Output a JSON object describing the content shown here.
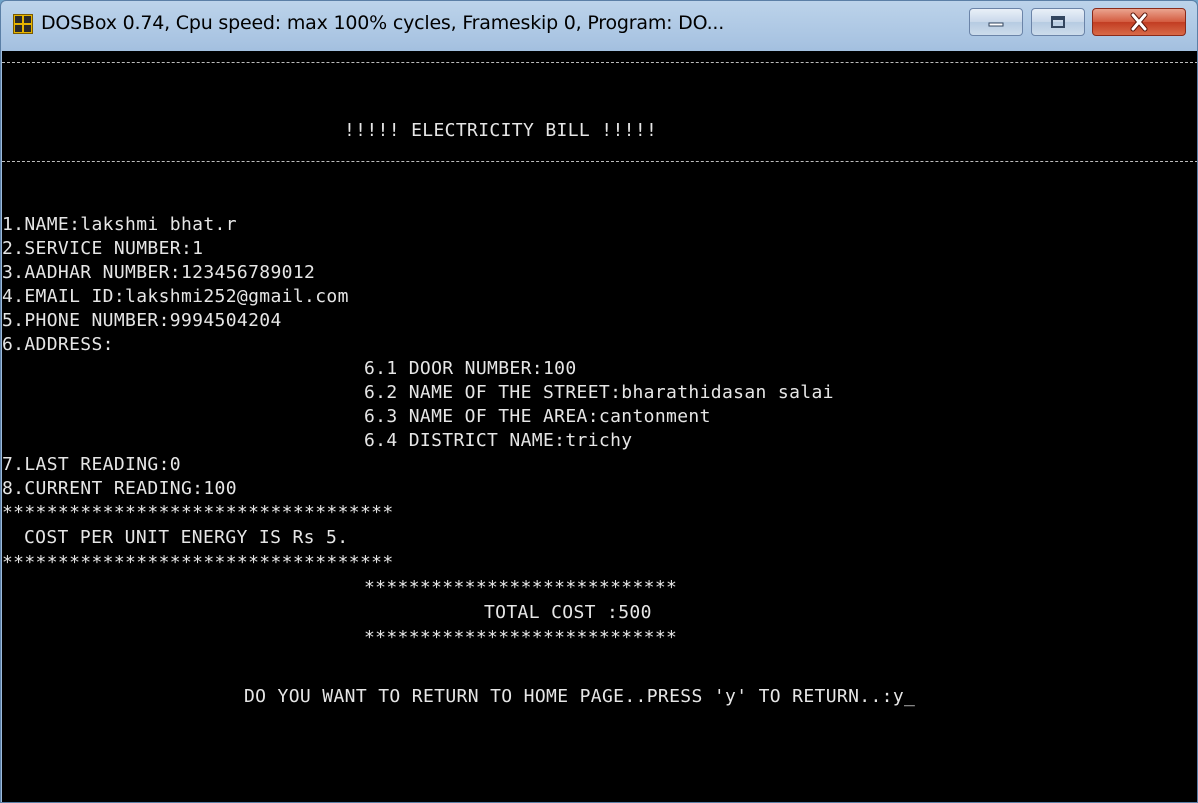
{
  "window": {
    "title": "DOSBox 0.74, Cpu speed: max 100% cycles, Frameskip  0, Program:   DO...",
    "icon": "dosbox-icon",
    "controls": [
      "minimize-icon",
      "maximize-icon",
      "close-icon"
    ]
  },
  "colors": {
    "close_button": "#c8442a",
    "screen_background": "#000000",
    "text": "#e6e6e6"
  },
  "console": {
    "header": "!!!!! ELECTRICITY BILL !!!!!",
    "fields": [
      "1.NAME:lakshmi bhat.r",
      "2.SERVICE NUMBER:1",
      "3.AADHAR NUMBER:123456789012",
      "4.EMAIL ID:lakshmi252@gmail.com",
      "5.PHONE NUMBER:9994504204",
      "6.ADDRESS:"
    ],
    "address": [
      "6.1 DOOR NUMBER:100",
      "6.2 NAME OF THE STREET:bharathidasan salai",
      "6.3 NAME OF THE AREA:cantonment",
      "6.4 DISTRICT NAME:trichy"
    ],
    "readings": [
      "7.LAST READING:0",
      "8.CURRENT READING:100"
    ],
    "stars_long": "***********************************",
    "cost_per_unit": "COST PER UNIT ENERGY IS Rs 5.",
    "stars_short": "****************************",
    "total_cost": "TOTAL COST :500",
    "prompt": "DO YOU WANT TO RETURN TO HOME PAGE..PRESS 'y' TO RETURN..:y_"
  }
}
